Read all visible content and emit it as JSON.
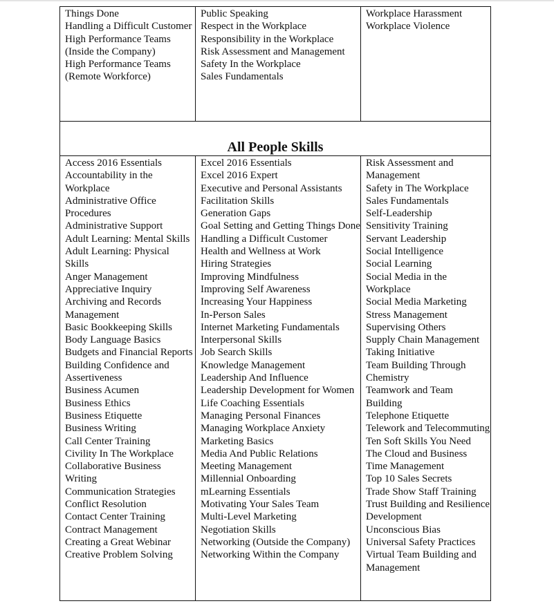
{
  "top_section": {
    "columns": [
      {
        "items": [
          "Things Done",
          "Handling a Difficult Customer",
          "High Performance Teams (Inside the Company)",
          "High Performance Teams (Remote Workforce)"
        ]
      },
      {
        "items": [
          "Public Speaking",
          "Respect in the Workplace",
          "Responsibility in the Workplace",
          "Risk Assessment and Management",
          "Safety In the Workplace",
          "Sales Fundamentals"
        ]
      },
      {
        "items": [
          "Workplace Harassment",
          "Workplace Violence"
        ]
      }
    ]
  },
  "all_people_skills": {
    "heading": "All People Skills",
    "columns": [
      {
        "items": [
          "Access 2016 Essentials",
          "Accountability in the Workplace",
          "Administrative Office Procedures",
          "Administrative Support",
          "Adult Learning: Mental Skills",
          "Adult Learning: Physical Skills",
          "Anger Management",
          "Appreciative Inquiry",
          "Archiving and Records Management",
          "Basic Bookkeeping Skills",
          "Body Language Basics",
          "Budgets and Financial Reports",
          "Building Confidence and Assertiveness",
          "Business Acumen",
          "Business Ethics",
          "Business Etiquette",
          "Business Writing",
          "Call Center Training",
          "Civility In The Workplace",
          "Collaborative Business Writing",
          "Communication Strategies",
          "Conflict Resolution",
          "Contact Center Training",
          "Contract Management",
          "Creating a Great Webinar",
          "Creative Problem Solving"
        ]
      },
      {
        "items": [
          "Excel 2016 Essentials",
          "Excel 2016 Expert",
          "Executive and Personal Assistants",
          "Facilitation Skills",
          "Generation Gaps",
          "Goal Setting and Getting Things Done",
          "Handling a Difficult Customer",
          "Health and Wellness at Work",
          "Hiring Strategies",
          "Improving Mindfulness",
          "Improving Self Awareness",
          "Increasing Your Happiness",
          "In-Person Sales",
          "Internet Marketing Fundamentals",
          "Interpersonal Skills",
          "Job Search Skills",
          "Knowledge Management",
          "Leadership And Influence",
          "Leadership Development for Women",
          "Life Coaching Essentials",
          "Managing Personal Finances",
          "Managing Workplace Anxiety",
          "Marketing Basics",
          "Media And Public Relations",
          "Meeting Management",
          "Millennial Onboarding",
          "mLearning Essentials",
          "Motivating Your Sales Team",
          "Multi-Level Marketing",
          "Negotiation Skills",
          "Networking (Outside the Company)",
          "Networking Within the Company"
        ]
      },
      {
        "items": [
          "Risk Assessment and Management",
          "Safety in The Workplace",
          "Sales Fundamentals",
          "Self-Leadership",
          "Sensitivity Training",
          "Servant Leadership",
          "Social Intelligence",
          "Social Learning",
          "Social Media in the Workplace",
          "Social Media Marketing",
          "Stress Management",
          "Supervising Others",
          "Supply Chain Management",
          "Taking Initiative",
          "Team Building Through Chemistry",
          "Teamwork and Team Building",
          "Telephone Etiquette",
          "Telework and Telecommuting",
          "Ten Soft Skills You Need",
          "The Cloud and Business",
          "Time Management",
          "Top 10 Sales Secrets",
          "Trade Show Staff Training",
          "Trust Building and Resilience Development",
          "Unconscious Bias",
          "Universal Safety Practices",
          "Virtual Team Building and Management"
        ]
      }
    ]
  }
}
